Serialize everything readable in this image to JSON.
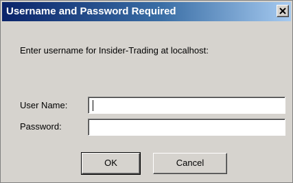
{
  "dialog": {
    "title": "Username and Password Required",
    "close_icon": "close-icon",
    "prompt": "Enter username for Insider-Trading at localhost:",
    "username_label": "User Name:",
    "username_value": "",
    "password_label": "Password:",
    "password_value": "",
    "ok_label": "OK",
    "cancel_label": "Cancel"
  },
  "colors": {
    "dialog_bg": "#d6d3ce",
    "title_gradient_start": "#0a246a",
    "title_gradient_end": "#a6caf0",
    "title_text": "#ffffff"
  }
}
